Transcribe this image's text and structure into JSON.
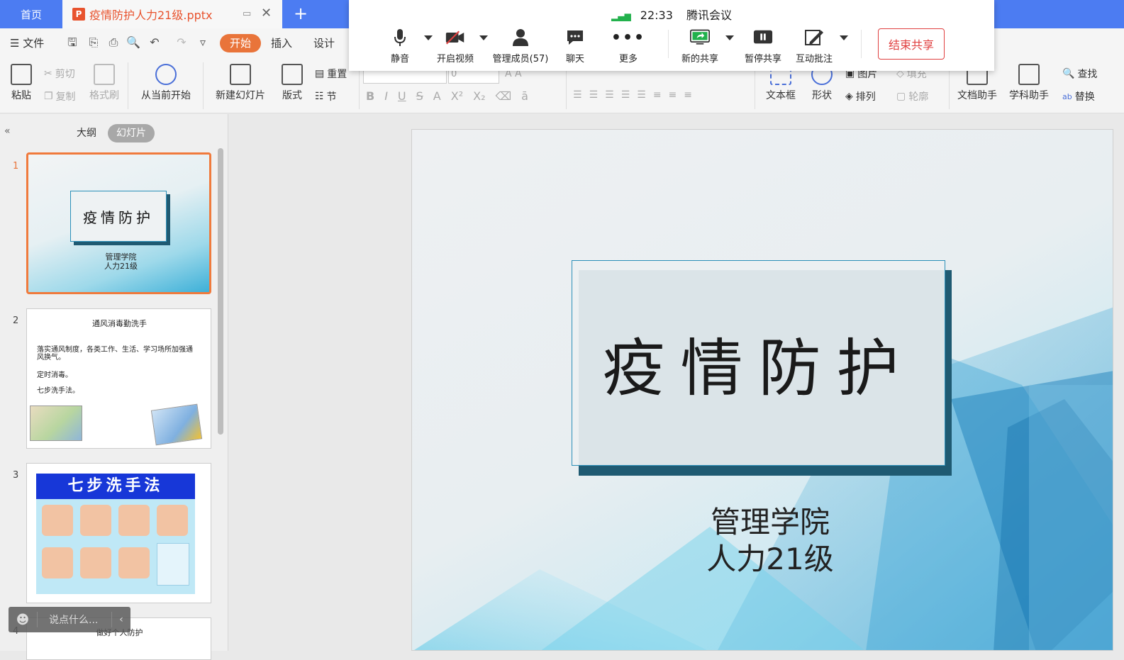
{
  "tabs": {
    "home": "首页",
    "doc_icon": "P",
    "doc_title": "疫情防护人力21级.pptx",
    "add": "+"
  },
  "menu": {
    "file": "文件",
    "start": "开始",
    "insert": "插入",
    "design": "设计"
  },
  "ribbon": {
    "paste": "粘贴",
    "cut": "剪切",
    "copy": "复制",
    "format_painter": "格式刷",
    "play_from_current": "从当前开始",
    "new_slide": "新建幻灯片",
    "layout": "版式",
    "reset": "重置",
    "section": "节",
    "font_size": "0",
    "text_box": "文本框",
    "shape": "形状",
    "picture": "图片",
    "fill": "填充",
    "arrange": "排列",
    "outline": "轮廓",
    "doc_assistant": "文档助手",
    "subject_assistant": "学科助手",
    "find": "查找",
    "replace": "替换"
  },
  "meeting": {
    "time": "22:33",
    "app_name": "腾讯会议",
    "mute": "静音",
    "start_video": "开启视频",
    "manage_members": "管理成员(57)",
    "chat": "聊天",
    "more": "更多",
    "new_share": "新的共享",
    "pause_share": "暂停共享",
    "annotate": "互动批注",
    "end_share": "结束共享",
    "signal_color": "#22b14c",
    "end_color": "#e04040"
  },
  "left_panel": {
    "outline_tab": "大纲",
    "slides_tab": "幻灯片",
    "slides": [
      {
        "num": "1",
        "title": "疫情防护",
        "sub1": "管理学院",
        "sub2": "人力21级"
      },
      {
        "num": "2",
        "title": "通风消毒勤洗手",
        "line1": "落实通风制度，各类工作、生活、学习场所加强通风换气。",
        "line2": "定时消毒。",
        "line3": "七步洗手法。"
      },
      {
        "num": "3",
        "title": "七步洗手法"
      },
      {
        "num": "4",
        "title": "做好个人防护"
      }
    ]
  },
  "comment": {
    "placeholder": "说点什么..."
  },
  "slide": {
    "title": "疫情防护",
    "subtitle1": "管理学院",
    "subtitle2": "人力21级"
  },
  "colors": {
    "tabbar": "#4c7cf2",
    "accent": "#e9743a",
    "title_border": "#2b8fb8",
    "title_shadow": "#1f5a72"
  }
}
